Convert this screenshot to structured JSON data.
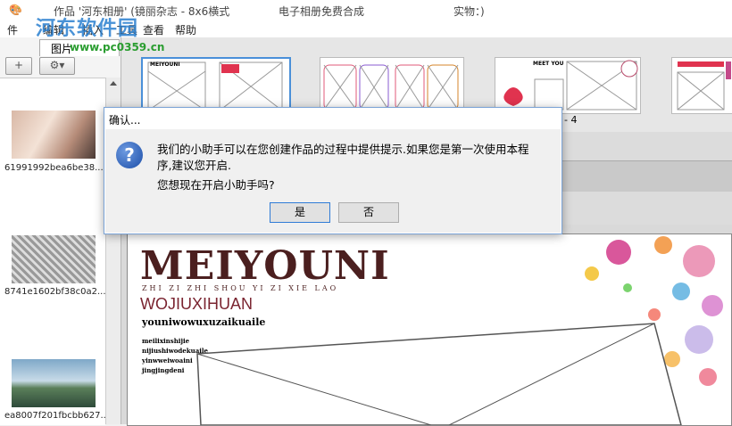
{
  "titlebar": {
    "title": "作品 '河东相册' (镜丽杂志 - 8x6横式",
    "mode": "电子相册免费合成",
    "status": "实物：)"
  },
  "watermark": {
    "name": "河东软件园",
    "url": "www.pc0359.cn"
  },
  "menubar": {
    "items": [
      "件",
      "编辑",
      "插入",
      "工具",
      "查看",
      "帮助"
    ]
  },
  "sidebar": {
    "tab_label": "图片",
    "add_button": "+",
    "settings_button": "⚙▾",
    "photos": [
      {
        "caption": "61991992bea6be38..."
      },
      {
        "caption": "8741e1602bf38c0a2..."
      },
      {
        "caption": "ea8007f201fbcbb627..."
      }
    ]
  },
  "templates": {
    "partial_label": "- 4",
    "first_label": "MEIYOUNI",
    "third_label": "MEET YOU"
  },
  "dialog": {
    "title": "确认...",
    "line1": "我们的小助手可以在您创建作品的过程中提供提示.如果您是第一次使用本程",
    "line2": "序,建议您开启.",
    "line3": "您想现在开启小助手吗?",
    "yes_label": "是",
    "no_label": "否",
    "icon": "question-icon"
  },
  "page": {
    "brand": "MEIYOUNI",
    "pinyin": "ZHI ZI ZHI SHOU YI ZI XIE LAO",
    "subtitle": "WOJIUXIHUAN",
    "tagline": "youniwowuxuzaikuaile",
    "lines": [
      "meilixinshijie",
      "nijiushiwodekuaile",
      "yinwweiwoaini",
      "jingjingdeni"
    ]
  }
}
